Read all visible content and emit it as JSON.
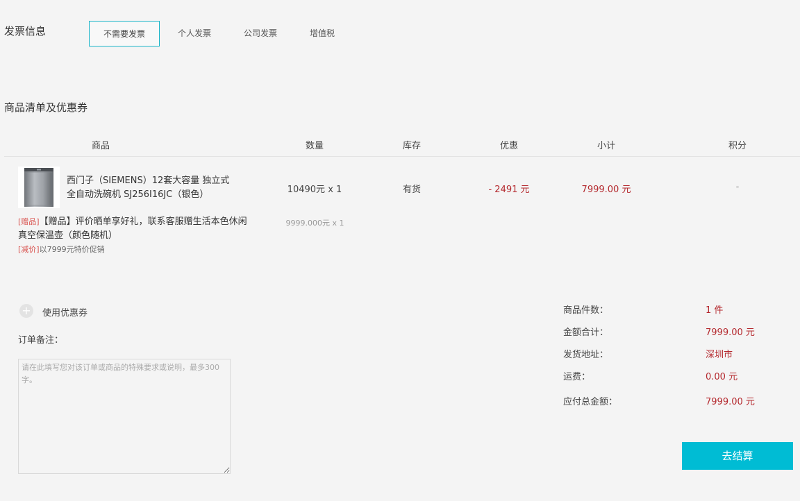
{
  "invoice": {
    "title": "发票信息",
    "options": [
      "不需要发票",
      "个人发票",
      "公司发票",
      "增值税"
    ]
  },
  "goods": {
    "title": "商品清单及优惠券",
    "headers": [
      "商品",
      "数量",
      "库存",
      "优惠",
      "小计",
      "积分"
    ],
    "item": {
      "name_line1": "西门子（SIEMENS）12套大容量 独立式",
      "name_line2": "全自动洗碗机 SJ256I16JC（银色）",
      "qty": "10490元 x 1",
      "stock": "有货",
      "discount": "- 2491 元",
      "subtotal": "7999.00 元",
      "points": "-"
    },
    "gift": {
      "tag": "[赠品]",
      "text_line1": "【赠品】评价晒单享好礼，联系客服赠生活本色休闲",
      "text_line2": "真空保温壶（颜色随机）",
      "price": "9999.000元 x 1"
    },
    "promo": {
      "tag": "[减价]",
      "text": "以7999元特价促销"
    }
  },
  "coupon": {
    "icon": "+",
    "label": "使用优惠券"
  },
  "remark": {
    "label": "订单备注：",
    "placeholder": "请在此填写您对该订单或商品的特殊要求或说明，最多300字。"
  },
  "summary": {
    "count_label": "商品件数：",
    "count_value": "1 件",
    "total_label": "金额合计：",
    "total_value": "7999.00 元",
    "address_label": "发货地址：",
    "address_value": "深圳市",
    "shipping_label": "运费：",
    "shipping_value": "0.00 元",
    "payable_label": "应付总金额：",
    "payable_value": "7999.00 元"
  },
  "checkout_label": "去结算",
  "colors": {
    "accent": "#00bcd4",
    "price": "#b4282d",
    "tag": "#d9534f"
  }
}
